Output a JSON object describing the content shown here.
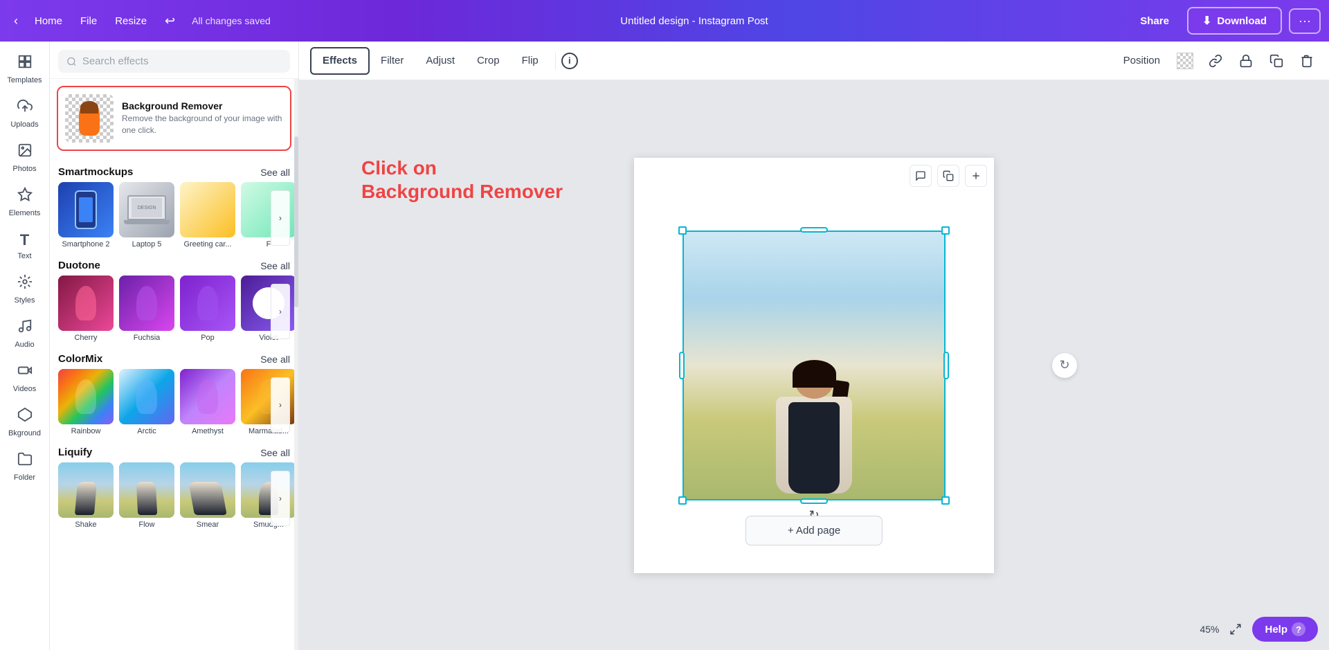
{
  "topbar": {
    "home_label": "Home",
    "file_label": "File",
    "resize_label": "Resize",
    "autosave_text": "All changes saved",
    "title": "Untitled design - Instagram Post",
    "share_label": "Share",
    "download_label": "Download",
    "more_label": "···"
  },
  "sidebar": {
    "items": [
      {
        "id": "templates",
        "label": "Templates",
        "icon": "⊞"
      },
      {
        "id": "uploads",
        "label": "Uploads",
        "icon": "↑"
      },
      {
        "id": "photos",
        "label": "Photos",
        "icon": "🖼"
      },
      {
        "id": "elements",
        "label": "Elements",
        "icon": "✦"
      },
      {
        "id": "text",
        "label": "Text",
        "icon": "T"
      },
      {
        "id": "styles",
        "label": "Styles",
        "icon": "✿"
      },
      {
        "id": "audio",
        "label": "Audio",
        "icon": "♫"
      },
      {
        "id": "videos",
        "label": "Videos",
        "icon": "▶"
      },
      {
        "id": "bkground",
        "label": "Bkground",
        "icon": "⬡"
      },
      {
        "id": "folder",
        "label": "Folder",
        "icon": "📁"
      }
    ]
  },
  "effects_panel": {
    "search_placeholder": "Search effects",
    "bg_remover": {
      "title": "Background Remover",
      "description": "Remove the background of your image with one click."
    },
    "smartmockups": {
      "title": "Smartmockups",
      "see_all": "See all",
      "items": [
        {
          "label": "Smartphone 2"
        },
        {
          "label": "Laptop 5"
        },
        {
          "label": "Greeting car..."
        },
        {
          "label": "F"
        }
      ]
    },
    "duotone": {
      "title": "Duotone",
      "see_all": "See all",
      "items": [
        {
          "label": "Cherry"
        },
        {
          "label": "Fuchsia"
        },
        {
          "label": "Pop"
        },
        {
          "label": "Violet"
        }
      ]
    },
    "colormix": {
      "title": "ColorMix",
      "see_all": "See all",
      "items": [
        {
          "label": "Rainbow"
        },
        {
          "label": "Arctic"
        },
        {
          "label": "Amethyst"
        },
        {
          "label": "Marmalad..."
        }
      ]
    },
    "liquify": {
      "title": "Liquify",
      "see_all": "See all",
      "items": [
        {
          "label": "Shake"
        },
        {
          "label": "Flow"
        },
        {
          "label": "Smear"
        },
        {
          "label": "Smudg..."
        }
      ]
    }
  },
  "toolbar": {
    "tabs": [
      {
        "label": "Effects",
        "active": true
      },
      {
        "label": "Filter"
      },
      {
        "label": "Adjust"
      },
      {
        "label": "Crop"
      },
      {
        "label": "Flip"
      }
    ],
    "position_label": "Position",
    "info_icon": "i"
  },
  "canvas": {
    "annotation_line1": "Click on",
    "annotation_line2": "Background Remover",
    "add_page_label": "+ Add page",
    "zoom_level": "45%",
    "rotate_icon": "↻"
  },
  "bottom": {
    "zoom": "45%",
    "help_label": "Help",
    "help_icon": "?"
  }
}
